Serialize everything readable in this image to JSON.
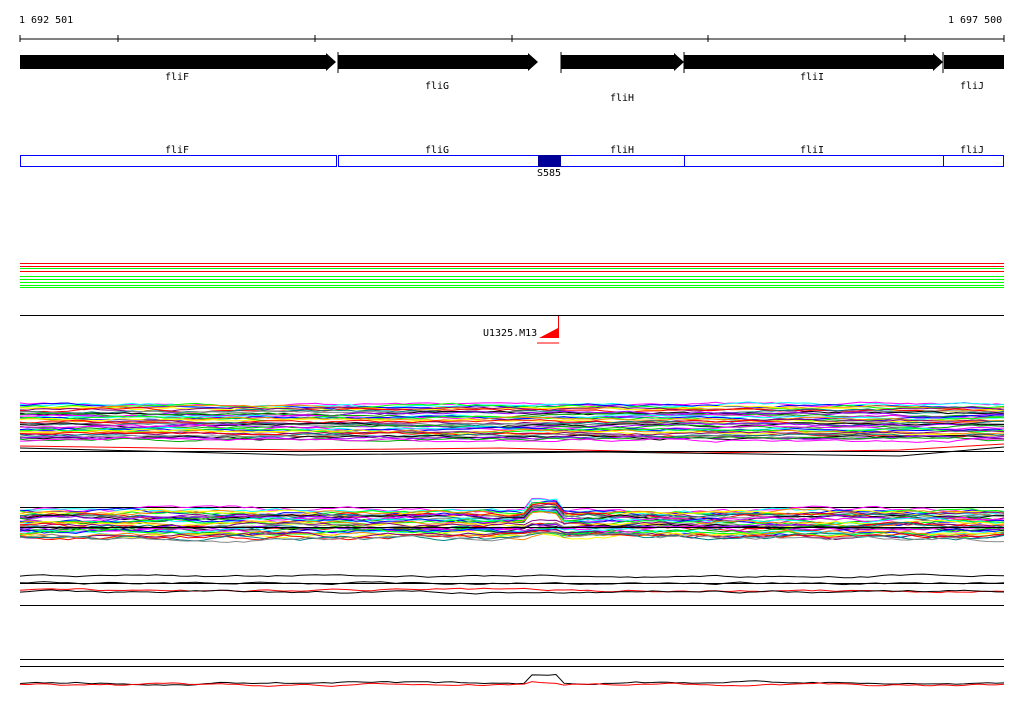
{
  "ruler": {
    "start": "1 692 501",
    "end": "1 697 500"
  },
  "genes": [
    {
      "label": "fliF"
    },
    {
      "label": "fliG"
    },
    {
      "label": "fliH"
    },
    {
      "label": "fliI"
    },
    {
      "label": "fliJ"
    }
  ],
  "features": [
    {
      "label": "fliF"
    },
    {
      "label": "fliG"
    },
    {
      "label": "fliH"
    },
    {
      "label": "fliI"
    },
    {
      "label": "fliJ"
    }
  ],
  "feature_marker": {
    "label": "S585"
  },
  "probe": {
    "label": "U1325.M13"
  },
  "colors": {
    "feature": "#0000ff",
    "marker": "#000099",
    "probe": "#ff0000"
  }
}
